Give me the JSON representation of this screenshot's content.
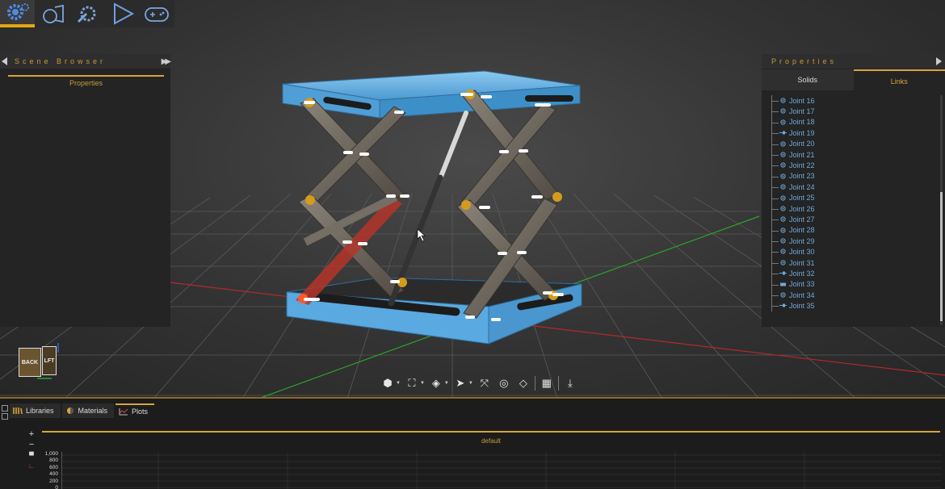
{
  "toolbar": {
    "buttons": [
      {
        "icon": "gear-icon",
        "active": true
      },
      {
        "icon": "solid-mirror-icon",
        "active": false
      },
      {
        "icon": "wrench-gear-icon",
        "active": false
      },
      {
        "icon": "play-icon",
        "active": false
      },
      {
        "icon": "gamepad-icon",
        "active": false
      }
    ]
  },
  "scene_browser": {
    "title": "Scene Browser",
    "tab": "Properties"
  },
  "properties": {
    "title": "Properties",
    "tabs": [
      "Solids",
      "Links"
    ],
    "active_tab": "Links",
    "joints": [
      {
        "label": "Joint 16",
        "icon": "revolute"
      },
      {
        "label": "Joint 17",
        "icon": "revolute"
      },
      {
        "label": "Joint 18",
        "icon": "revolute"
      },
      {
        "label": "Joint 19",
        "icon": "prismatic"
      },
      {
        "label": "Joint 20",
        "icon": "revolute"
      },
      {
        "label": "Joint 21",
        "icon": "revolute"
      },
      {
        "label": "Joint 22",
        "icon": "revolute"
      },
      {
        "label": "Joint 23",
        "icon": "revolute"
      },
      {
        "label": "Joint 24",
        "icon": "revolute"
      },
      {
        "label": "Joint 25",
        "icon": "revolute"
      },
      {
        "label": "Joint 26",
        "icon": "revolute"
      },
      {
        "label": "Joint 27",
        "icon": "revolute"
      },
      {
        "label": "Joint 28",
        "icon": "revolute"
      },
      {
        "label": "Joint 29",
        "icon": "revolute"
      },
      {
        "label": "Joint 30",
        "icon": "revolute"
      },
      {
        "label": "Joint 31",
        "icon": "revolute"
      },
      {
        "label": "Joint 32",
        "icon": "prismatic"
      },
      {
        "label": "Joint 33",
        "icon": "fixed"
      },
      {
        "label": "Joint 34",
        "icon": "revolute"
      },
      {
        "label": "Joint 35",
        "icon": "prismatic"
      }
    ]
  },
  "viewcube": {
    "back": "BACK",
    "left": "LFT"
  },
  "viewport_toolbar": [
    "view-cube-icon",
    "frame-icon",
    "shaded-cube-icon",
    "select-cursor-icon",
    "move-icon",
    "measure-icon",
    "layers-icon",
    "grid-icon",
    "export-icon"
  ],
  "bottom_panel": {
    "tabs": [
      {
        "label": "Libraries",
        "icon": "books-icon"
      },
      {
        "label": "Materials",
        "icon": "material-sphere-icon"
      },
      {
        "label": "Plots",
        "icon": "plot-icon"
      }
    ],
    "active_tab": "Plots",
    "plot_title": "default",
    "y_ticks": [
      "1,000",
      "800",
      "600",
      "400",
      "200",
      "0"
    ],
    "plot_tools": [
      "+",
      "−"
    ]
  },
  "colors": {
    "accent": "#d7a43a",
    "frame_blue": "#5aa9e0",
    "link_gray": "#6b645b",
    "actuator_red": "#b4352a",
    "joint_label": "#6fa8d8"
  }
}
